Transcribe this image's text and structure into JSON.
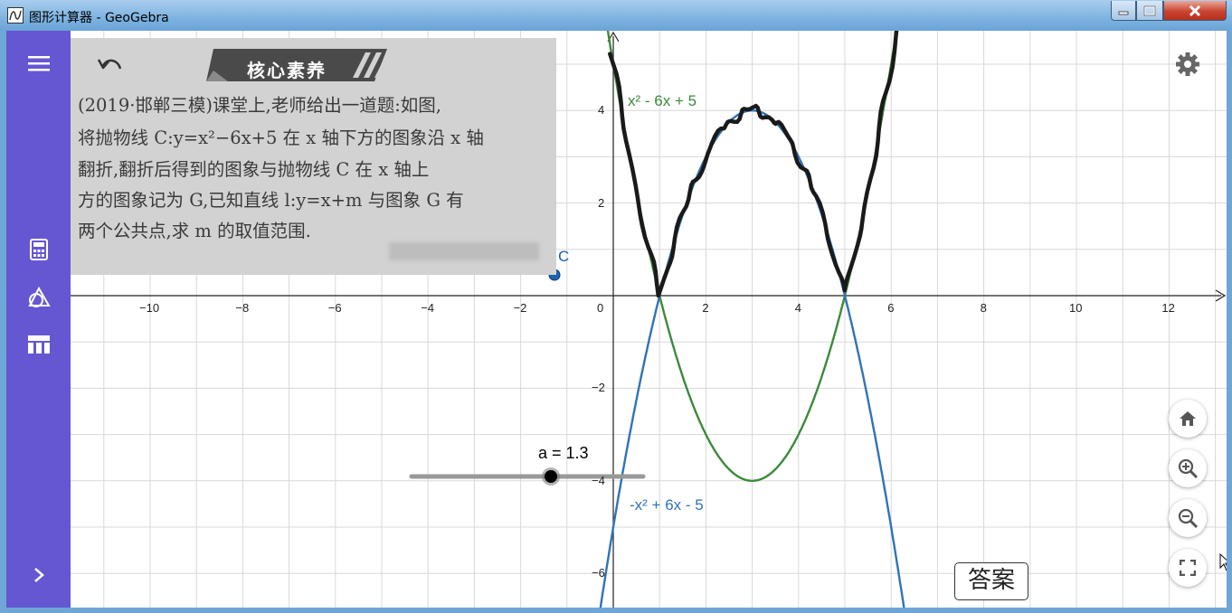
{
  "window": {
    "title": "图形计算器 - GeoGebra",
    "min_icon": "minimize-icon",
    "max_icon": "maximize-icon",
    "close_icon": "close-icon"
  },
  "sidebar": {
    "items": [
      {
        "name": "menu",
        "icon": "hamburger-menu-icon"
      },
      {
        "name": "algebra",
        "icon": "calculator-icon"
      },
      {
        "name": "tools",
        "icon": "geometry-tools-icon"
      },
      {
        "name": "table",
        "icon": "table-icon"
      },
      {
        "name": "expand",
        "icon": "chevron-right-icon"
      }
    ],
    "color": "#6557d2"
  },
  "photo": {
    "banner": "核心素养",
    "lines": [
      "(2019·邯郸三模)课堂上,老师给出一道题:如图,",
      "将抛物线 C:y=x²−6x+5 在 x 轴下方的图象沿 x 轴",
      "翻折,翻折后得到的图象与抛物线 C 在 x 轴上",
      "方的图象记为 G,已知直线 l:y=x+m 与图象 G 有",
      "两个公共点,求 m 的取值范围."
    ]
  },
  "graph": {
    "x_ticks": [
      "−10",
      "−8",
      "−6",
      "−4",
      "−2",
      "0",
      "2",
      "4",
      "6",
      "8",
      "10",
      "12"
    ],
    "y_ticks": [
      "4",
      "2",
      "−2",
      "−4",
      "−6"
    ],
    "functions": [
      {
        "label": "x² - 6x + 5",
        "color": "#3c8a3a"
      },
      {
        "label": "-x² + 6x - 5",
        "color": "#2f73b8"
      }
    ],
    "point_label": "C",
    "slider": {
      "label": "a = 1.3",
      "value": 1.3
    }
  },
  "buttons": {
    "answer": "答案",
    "undo_icon": "undo-icon",
    "settings_icon": "gear-icon",
    "home_icon": "home-icon",
    "zoom_in_icon": "zoom-in-icon",
    "zoom_out_icon": "zoom-out-icon",
    "fullscreen_icon": "fullscreen-icon"
  },
  "colors": {
    "titlebar": "#7db3e0",
    "sidebar": "#6557d2",
    "green_curve": "#3c8a3a",
    "blue_curve": "#2f73b8",
    "ink_curve": "#1a1a1a",
    "point": "#1d61b0"
  }
}
